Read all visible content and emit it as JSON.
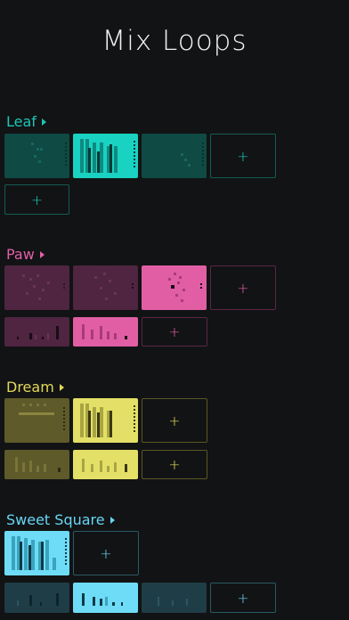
{
  "app": {
    "title": "Mix Loops"
  },
  "add_symbol": "+",
  "groups": [
    {
      "name": "Leaf",
      "color": "#1bc7b8",
      "dim": "#0f4a45",
      "bright": "#19d2c2",
      "border": "#125c55"
    },
    {
      "name": "Paw",
      "color": "#e05fa7",
      "dim": "#4f2541",
      "bright": "#e15ea5",
      "border": "#5a2648"
    },
    {
      "name": "Dream",
      "color": "#e3d85a",
      "dim": "#5e5a2a",
      "bright": "#e4e067",
      "border": "#5c5726"
    },
    {
      "name": "Sweet Square",
      "color": "#67d6f5",
      "dim": "#1f3d47",
      "bright": "#6edcf7",
      "border": "#285a67"
    }
  ]
}
